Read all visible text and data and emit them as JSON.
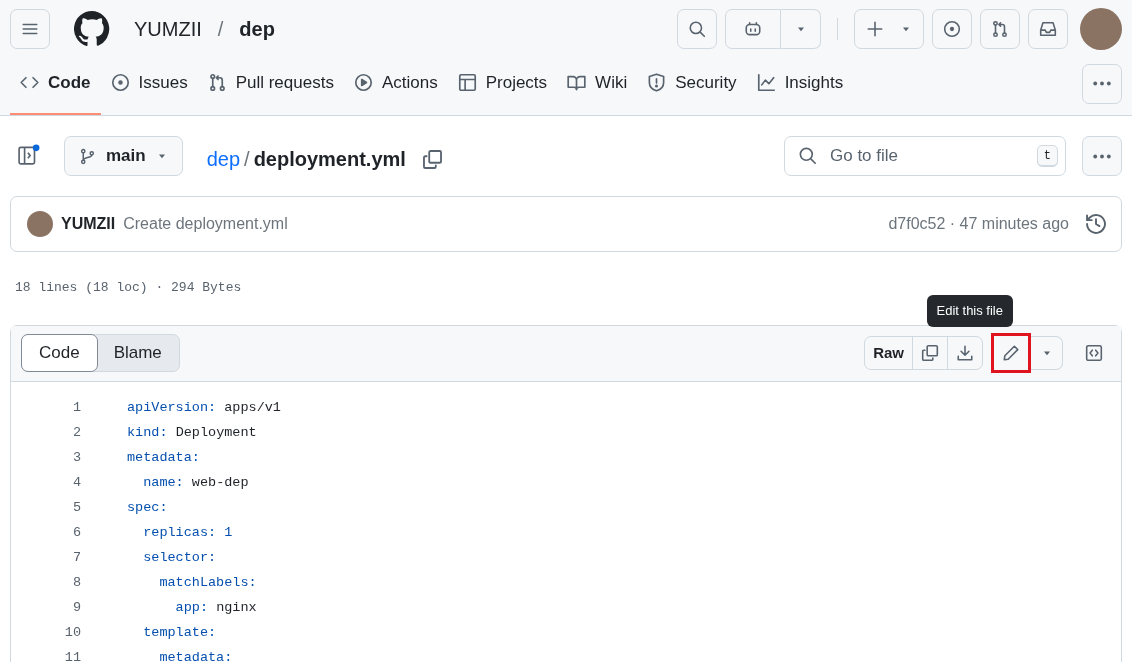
{
  "header": {
    "owner": "YUMZII",
    "separator": "/",
    "repo": "dep"
  },
  "tabs": [
    {
      "label": "Code",
      "selected": true
    },
    {
      "label": "Issues",
      "selected": false
    },
    {
      "label": "Pull requests",
      "selected": false
    },
    {
      "label": "Actions",
      "selected": false
    },
    {
      "label": "Projects",
      "selected": false
    },
    {
      "label": "Wiki",
      "selected": false
    },
    {
      "label": "Security",
      "selected": false
    },
    {
      "label": "Insights",
      "selected": false
    }
  ],
  "file_bar": {
    "branch": "main",
    "repo_link": "dep",
    "separator": "/",
    "file_name": "deployment.yml",
    "search": {
      "placeholder": "Go to file",
      "shortcut": "t"
    }
  },
  "commit": {
    "author": "YUMZII",
    "message": "Create deployment.yml",
    "hash_time": "d7f0c52 · 47 minutes ago"
  },
  "file_meta": "18 lines (18 loc) · 294 Bytes",
  "viewer": {
    "modes": [
      {
        "label": "Code",
        "selected": true
      },
      {
        "label": "Blame",
        "selected": false
      }
    ],
    "raw_button": "Raw",
    "tooltip": "Edit this file",
    "edit_highlighted": true,
    "lines": [
      {
        "number": "1",
        "key": "apiVersion:",
        "value": "apps/v1",
        "kind": "string"
      },
      {
        "number": "2",
        "key": "kind:",
        "value": "Deployment",
        "kind": "string"
      },
      {
        "number": "3",
        "key": "metadata:",
        "kind": "section"
      },
      {
        "number": "4",
        "key": "  name:",
        "value": "web-dep",
        "kind": "string"
      },
      {
        "number": "5",
        "key": "spec:",
        "kind": "section"
      },
      {
        "number": "6",
        "key": "  replicas:",
        "value": "1",
        "kind": "number"
      },
      {
        "number": "7",
        "key": "  selector:",
        "kind": "section"
      },
      {
        "number": "8",
        "key": "    matchLabels:",
        "kind": "section"
      },
      {
        "number": "9",
        "key": "      app:",
        "value": "nginx",
        "kind": "string"
      },
      {
        "number": "10",
        "key": "  template:",
        "kind": "section"
      },
      {
        "number": "11",
        "key": "    metadata:",
        "kind": "section"
      }
    ]
  }
}
